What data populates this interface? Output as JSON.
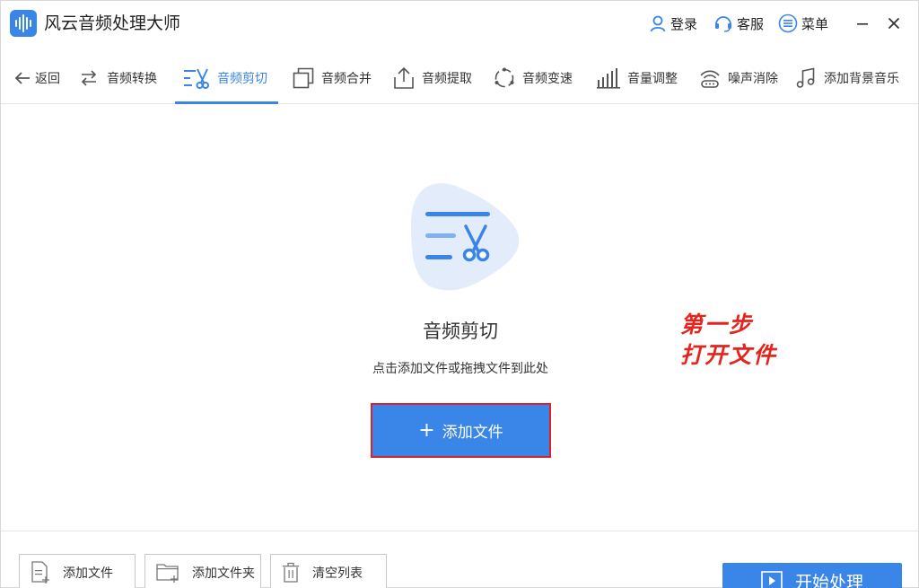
{
  "app": {
    "title": "风云音频处理大师",
    "login_label": "登录",
    "service_label": "客服",
    "menu_label": "菜单"
  },
  "toolbar": {
    "back_label": "返回",
    "tools": [
      {
        "label": "音频转换",
        "icon": "convert-icon"
      },
      {
        "label": "音频剪切",
        "icon": "scissors-icon",
        "active": true
      },
      {
        "label": "音频合并",
        "icon": "merge-icon"
      },
      {
        "label": "音频提取",
        "icon": "extract-icon"
      },
      {
        "label": "音频变速",
        "icon": "speed-icon"
      },
      {
        "label": "音量调整",
        "icon": "volume-icon"
      },
      {
        "label": "噪声消除",
        "icon": "noise-icon"
      },
      {
        "label": "添加背景音乐",
        "icon": "music-note-icon"
      }
    ]
  },
  "main": {
    "title": "音频剪切",
    "subtitle": "点击添加文件或拖拽文件到此处",
    "add_file_label": "添加文件",
    "annotation_line1": "第一步",
    "annotation_line2": "打开文件"
  },
  "bottom": {
    "add_file_label": "添加文件",
    "add_folder_label": "添加文件夹",
    "clear_list_label": "清空列表",
    "start_label": "开始处理"
  },
  "colors": {
    "accent": "#3a86e8",
    "highlight_border": "#d8232a",
    "annotation": "#e3251e",
    "hero_bg": "#e3ecfa"
  }
}
